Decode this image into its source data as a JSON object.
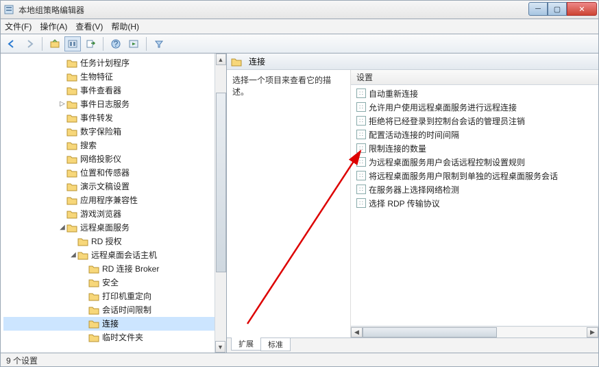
{
  "window": {
    "title": "本地组策略编辑器"
  },
  "menu": {
    "file": "文件(F)",
    "action": "操作(A)",
    "view": "查看(V)",
    "help": "帮助(H)"
  },
  "tree": [
    {
      "indent": 5,
      "twist": "",
      "label": "任务计划程序"
    },
    {
      "indent": 5,
      "twist": "",
      "label": "生物特征"
    },
    {
      "indent": 5,
      "twist": "",
      "label": "事件查看器"
    },
    {
      "indent": 5,
      "twist": "▷",
      "label": "事件日志服务"
    },
    {
      "indent": 5,
      "twist": "",
      "label": "事件转发"
    },
    {
      "indent": 5,
      "twist": "",
      "label": "数字保险箱"
    },
    {
      "indent": 5,
      "twist": "",
      "label": "搜索"
    },
    {
      "indent": 5,
      "twist": "",
      "label": "网络投影仪"
    },
    {
      "indent": 5,
      "twist": "",
      "label": "位置和传感器"
    },
    {
      "indent": 5,
      "twist": "",
      "label": "演示文稿设置"
    },
    {
      "indent": 5,
      "twist": "",
      "label": "应用程序兼容性"
    },
    {
      "indent": 5,
      "twist": "",
      "label": "游戏浏览器"
    },
    {
      "indent": 5,
      "twist": "◢",
      "label": "远程桌面服务"
    },
    {
      "indent": 6,
      "twist": "",
      "label": "RD 授权"
    },
    {
      "indent": 6,
      "twist": "◢",
      "label": "远程桌面会话主机"
    },
    {
      "indent": 7,
      "twist": "",
      "label": "RD 连接 Broker"
    },
    {
      "indent": 7,
      "twist": "",
      "label": "安全"
    },
    {
      "indent": 7,
      "twist": "",
      "label": "打印机重定向"
    },
    {
      "indent": 7,
      "twist": "",
      "label": "会话时间限制"
    },
    {
      "indent": 7,
      "twist": "",
      "label": "连接",
      "selected": true
    },
    {
      "indent": 7,
      "twist": "",
      "label": "临时文件夹"
    }
  ],
  "right": {
    "header": "连接",
    "description": "选择一个项目来查看它的描述。",
    "column": "设置",
    "items": [
      "自动重新连接",
      "允许用户使用远程桌面服务进行远程连接",
      "拒绝将已经登录到控制台会话的管理员注销",
      "配置活动连接的时间间隔",
      "限制连接的数量",
      "为远程桌面服务用户会话远程控制设置规则",
      "将远程桌面服务用户限制到单独的远程桌面服务会话",
      "在服务器上选择网络检测",
      "选择 RDP 传输协议"
    ],
    "tabs": {
      "extended": "扩展",
      "standard": "标准"
    }
  },
  "status": "9 个设置"
}
